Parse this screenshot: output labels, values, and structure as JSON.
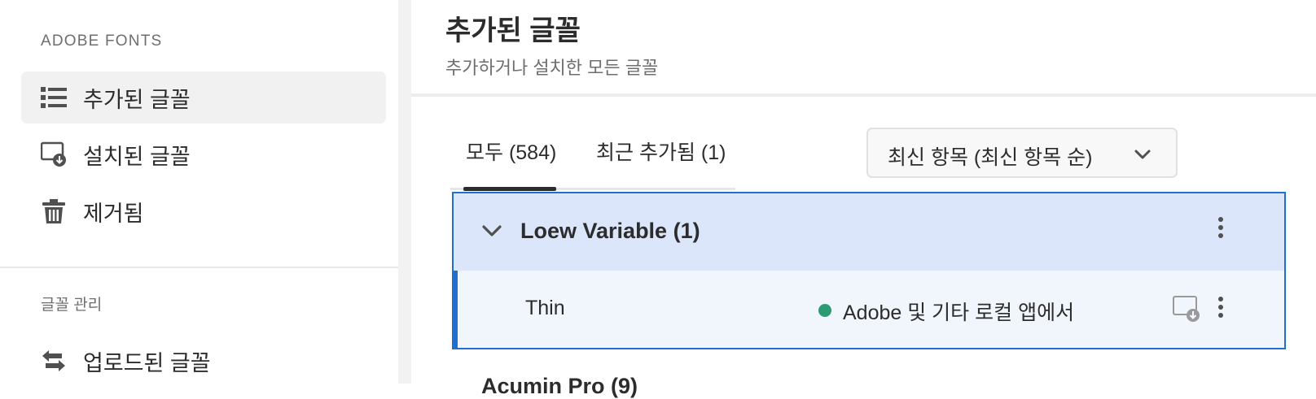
{
  "sidebar": {
    "section_adobe": "ADOBE FONTS",
    "items": [
      {
        "label": "추가된 글꼴",
        "icon": "list-icon",
        "active": true
      },
      {
        "label": "설치된 글꼴",
        "icon": "installed-monitor-icon"
      },
      {
        "label": "제거됨",
        "icon": "trash-icon"
      }
    ],
    "section_manage": "글꼴 관리",
    "manage_items": [
      {
        "label": "업로드된 글꼴",
        "icon": "transfer-arrows-icon"
      }
    ]
  },
  "header": {
    "title": "추가된 글꼴",
    "subtitle": "추가하거나 설치한 모든 글꼴"
  },
  "tabs": [
    {
      "label": "모두 (584)",
      "active": true
    },
    {
      "label": "최근 추가됨 (1)"
    }
  ],
  "sort": {
    "label": "최신 항목 (최신 항목 순)",
    "icon": "chevron-down-icon"
  },
  "font_list": {
    "groups": [
      {
        "name": "Loew Variable (1)",
        "expanded": true,
        "styles": [
          {
            "name": "Thin",
            "status": "Adobe 및 기타 로컬 앱에서",
            "status_color": "#2a9b73"
          }
        ]
      },
      {
        "name": "Acumin Pro (9)"
      }
    ]
  },
  "colors": {
    "accent": "#1e6fd0",
    "selected_bg": "#dbe6fa",
    "status_active": "#2a9b73"
  }
}
